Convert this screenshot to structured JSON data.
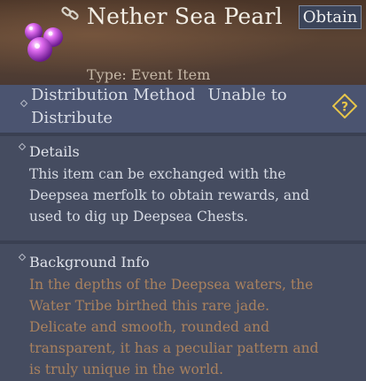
{
  "item": {
    "name": "Nether Sea Pearl",
    "type_line": "Type: Event Item",
    "obtain_label": "Obtain"
  },
  "distribution": {
    "label": "Distribution Method",
    "value": "Unable to Distribute"
  },
  "details": {
    "title": "Details",
    "text": "This item can be exchanged with the Deepsea merfolk to obtain rewards, and used to dig up Deepsea Chests."
  },
  "background": {
    "title": "Background Info",
    "text": "In the depths of the Deepsea waters, the Water Tribe birthed this rare jade. Delicate and smooth, rounded and transparent, it has a peculiar pattern and is truly unique in the world."
  },
  "icons": {
    "item": "purple-pearl-cluster-icon",
    "link": "chain-link-icon",
    "help": "question-diamond-icon"
  },
  "colors": {
    "title": "#f3efe6",
    "background_text": "#a9815e",
    "help_icon": "#e8c64a"
  }
}
